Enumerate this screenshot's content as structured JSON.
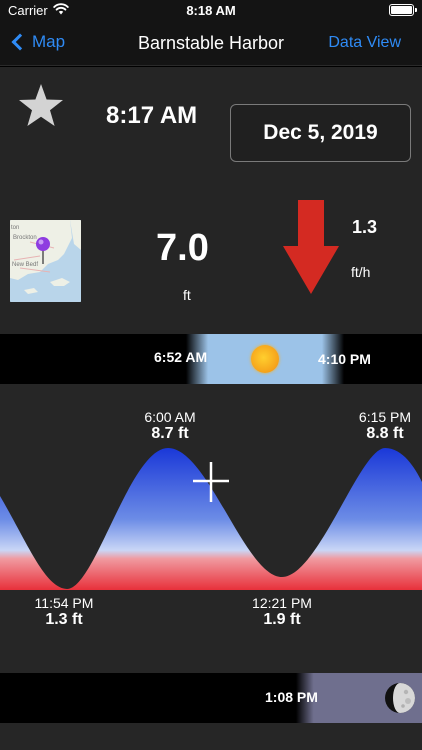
{
  "status": {
    "carrier": "Carrier",
    "time": "8:18 AM"
  },
  "nav": {
    "back_label": "Map",
    "title": "Barnstable Harbor",
    "right_label": "Data View"
  },
  "info": {
    "current_time": "8:17 AM",
    "date": "Dec 5, 2019",
    "height_value": "7.0",
    "height_unit": "ft",
    "rate_value": "1.3",
    "rate_unit": "ft/h",
    "trend": "falling",
    "map_labels": [
      "ton",
      "Brockton",
      "New Bedf"
    ]
  },
  "sun": {
    "sunrise": "6:52 AM",
    "sunset": "4:10 PM"
  },
  "tides": {
    "high_1": {
      "time": "6:00 AM",
      "height": "8.7 ft"
    },
    "high_2": {
      "time": "6:15 PM",
      "height": "8.8 ft"
    },
    "low_1": {
      "time": "11:54 PM",
      "height": "1.3 ft"
    },
    "low_2": {
      "time": "12:21 PM",
      "height": "1.9 ft"
    }
  },
  "moon": {
    "moonrise": "1:08 PM"
  },
  "colors": {
    "accent": "#2f8bf5",
    "arrow": "#d42a22",
    "water_high": "#1a38d8",
    "water_low": "#e8303a",
    "background": "#262626"
  }
}
